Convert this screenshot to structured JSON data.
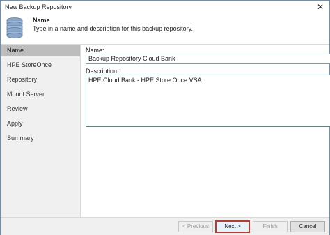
{
  "window": {
    "title": "New Backup Repository",
    "close_glyph": "✕"
  },
  "header": {
    "icon": "database-icon",
    "title": "Name",
    "description": "Type in a name and description for this backup repository."
  },
  "sidebar": {
    "items": [
      {
        "label": "Name",
        "active": true
      },
      {
        "label": "HPE StoreOnce",
        "active": false
      },
      {
        "label": "Repository",
        "active": false
      },
      {
        "label": "Mount Server",
        "active": false
      },
      {
        "label": "Review",
        "active": false
      },
      {
        "label": "Apply",
        "active": false
      },
      {
        "label": "Summary",
        "active": false
      }
    ]
  },
  "form": {
    "name_label": "Name:",
    "name_value": "Backup Repository Cloud Bank",
    "description_label": "Description:",
    "description_value": "HPE Cloud Bank -  HPE Store Once VSA"
  },
  "footer": {
    "previous_label": "< Previous",
    "next_label": "Next >",
    "finish_label": "Finish",
    "cancel_label": "Cancel"
  },
  "colors": {
    "accent_border": "#c0392b",
    "sidebar_active": "#bdbdbd",
    "input_focus": "#4a7fcf"
  }
}
